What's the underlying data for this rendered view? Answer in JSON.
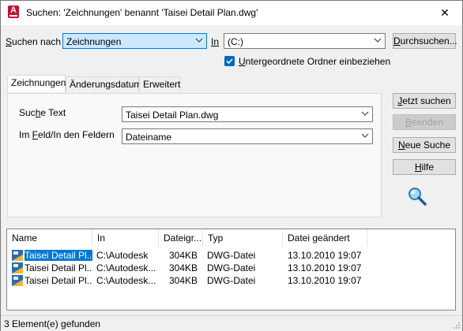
{
  "window": {
    "title": "Suchen: 'Zeichnungen' benannt 'Taisei Detail Plan.dwg'",
    "app_icon_letter": "A",
    "close_symbol": "✕"
  },
  "search": {
    "search_for_label_u": "S",
    "search_for_label_rest": "uchen nach",
    "search_for_value": "Zeichnungen",
    "in_label": "In",
    "in_value": "(C:)",
    "browse_label": "Durchsuchen...",
    "browse_u": "D",
    "subfolders_label_u": "U",
    "subfolders_label_rest": "ntergeordnete Ordner einbeziehen",
    "subfolders_checked": true
  },
  "tabs": [
    "Zeichnungen",
    "Änderungsdatum",
    "Erweitert"
  ],
  "panel": {
    "search_text_label_a": "Suc",
    "search_text_label_u": "h",
    "search_text_label_b": "e Text",
    "search_text_value": "Taisei Detail Plan.dwg",
    "field_label_a": "Im ",
    "field_label_u": "F",
    "field_label_b": "eld/In den Feldern",
    "field_value": "Dateiname"
  },
  "buttons": {
    "search_now": "Jetzt suchen",
    "stop": "Beenden",
    "new_search": "Neue Suche",
    "help": "Hilfe"
  },
  "results": {
    "columns": [
      "Name",
      "In",
      "Dateigr...",
      "Typ",
      "Datei geändert"
    ],
    "rows": [
      {
        "name": "Taisei Detail Pl...",
        "in": "C:\\Autodesk",
        "size": "304KB",
        "type": "DWG-Datei",
        "modified": "13.10.2010 19:07"
      },
      {
        "name": "Taisei Detail Pl...",
        "in": "C:\\Autodesk...",
        "size": "304KB",
        "type": "DWG-Datei",
        "modified": "13.10.2010 19:07"
      },
      {
        "name": "Taisei Detail Pl...",
        "in": "C:\\Autodesk...",
        "size": "304KB",
        "type": "DWG-Datei",
        "modified": "13.10.2010 19:07"
      }
    ]
  },
  "status": {
    "text": "3 Element(e) gefunden"
  },
  "colors": {
    "accent": "#0078d7",
    "app_icon": "#c8102e"
  },
  "icons": {
    "app": "autocad-icon",
    "search": "magnifier-icon",
    "file": "dwg-file-icon"
  }
}
